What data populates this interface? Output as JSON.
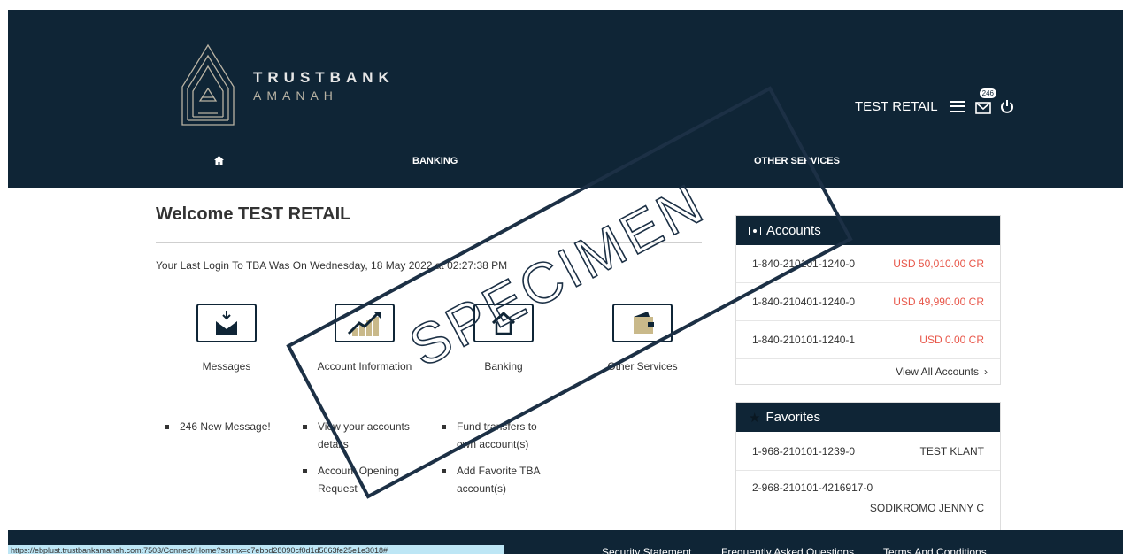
{
  "brand": {
    "line1": "TRUSTBANK",
    "line2": "AMANAH"
  },
  "user": {
    "name": "TEST RETAIL",
    "message_count": "246"
  },
  "nav": {
    "home_icon": "home-icon",
    "banking": "BANKING",
    "other_services": "OTHER SERVICES"
  },
  "main": {
    "welcome": "Welcome TEST RETAIL",
    "last_login": "Your Last Login To TBA Was On Wednesday, 18 May 2022 at 02:27:38 PM",
    "tiles": [
      {
        "label": "Messages",
        "icon": "envelope-download-icon"
      },
      {
        "label": "Account Information",
        "icon": "chart-up-icon"
      },
      {
        "label": "Banking",
        "icon": "house-icon"
      },
      {
        "label": "Other Services",
        "icon": "wallet-icon"
      }
    ],
    "messages_bullets": [
      "246 New Message!"
    ],
    "account_bullets": [
      "View your accounts details",
      "Account Opening Request"
    ],
    "banking_bullets": [
      "Fund transfers to own account(s)",
      "Add Favorite TBA account(s)"
    ]
  },
  "accounts": {
    "title": "Accounts",
    "rows": [
      {
        "number": "1-840-210101-1240-0",
        "amount": "USD 50,010.00 CR"
      },
      {
        "number": "1-840-210401-1240-0",
        "amount": "USD 49,990.00 CR"
      },
      {
        "number": "1-840-210101-1240-1",
        "amount": "USD 0.00 CR"
      }
    ],
    "view_all": "View All Accounts"
  },
  "favorites": {
    "title": "Favorites",
    "rows": [
      {
        "number": "1-968-210101-1239-0",
        "name": "TEST KLANT"
      },
      {
        "number": "2-968-210101-4216917-0",
        "name": "SODIKROMO JENNY C"
      }
    ]
  },
  "footer": {
    "status_url": "https://ebplust.trustbankamanah.com:7503/Connect/Home?ssrmx=c7ebbd28090cf0d1d5063fe25e1e3018#",
    "links": [
      "Security Statement",
      "Frequently Asked Questions",
      "Terms And Conditions"
    ]
  },
  "watermark": "SPECIMEN",
  "colors": {
    "header": "#0f2536",
    "amount": "#e8574a"
  }
}
